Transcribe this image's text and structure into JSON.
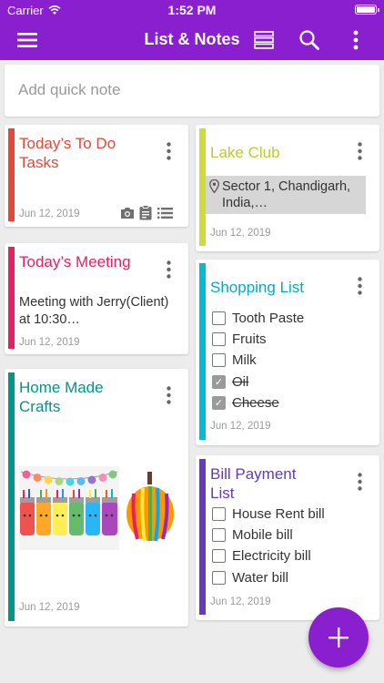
{
  "status": {
    "carrier": "Carrier",
    "time": "1:52 PM"
  },
  "toolbar": {
    "title": "List & Notes"
  },
  "quick_note": {
    "placeholder": "Add quick note"
  },
  "theme": {
    "primary": "#8a1fd0"
  },
  "notes": {
    "todo": {
      "title": "Today’s To Do Tasks",
      "date": "Jun 12, 2019",
      "color": "#e84637"
    },
    "meeting": {
      "title": "Today’s Meeting",
      "body": "Meeting with Jerry(Client) at 10:30…",
      "date": "Jun 12, 2019",
      "color": "#e91e63"
    },
    "crafts": {
      "title": "Home Made Crafts",
      "date": "Jun 12, 2019",
      "color": "#009688"
    },
    "lake": {
      "title": "Lake Club",
      "location": "Sector 1, Chandigarh, India,…",
      "date": "Jun 12, 2019",
      "color": "#cddc39"
    },
    "shopping": {
      "title": "Shopping List",
      "date": "Jun 12, 2019",
      "color": "#00bcd4",
      "items": [
        {
          "label": "Tooth Paste",
          "checked": false
        },
        {
          "label": "Fruits",
          "checked": false
        },
        {
          "label": "Milk",
          "checked": false
        },
        {
          "label": "Oil",
          "checked": true
        },
        {
          "label": "Cheese",
          "checked": true
        }
      ]
    },
    "bills": {
      "title": "Bill Payment List",
      "date": "Jun 12, 2019",
      "color": "#673ab7",
      "items": [
        {
          "label": "House Rent bill",
          "checked": false
        },
        {
          "label": "Mobile bill",
          "checked": false
        },
        {
          "label": "Electricity bill",
          "checked": false
        },
        {
          "label": "Water bill",
          "checked": false
        }
      ]
    }
  }
}
